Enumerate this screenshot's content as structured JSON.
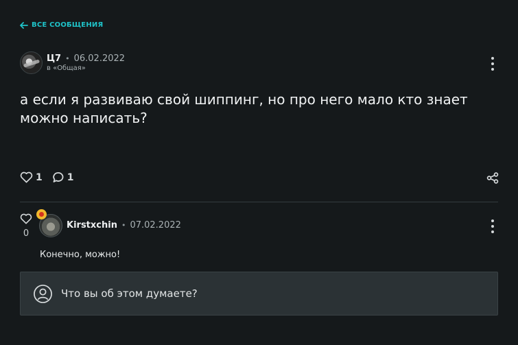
{
  "nav": {
    "back_label": "ВСЕ СООБЩЕНИЯ",
    "back_icon": "arrow-left-icon",
    "accent": "#1fc3c9"
  },
  "post": {
    "author": "Ц7",
    "separator": "•",
    "date": "06.02.2022",
    "category": "в «Общая»",
    "body": "а если я развиваю свой шиппинг, но про него мало кто знает можно написать?",
    "likes": "1",
    "comments": "1"
  },
  "comment": {
    "likes": "0",
    "author": "Kirstxchin",
    "separator": "•",
    "date": "07.02.2022",
    "body": "Конечно, можно!"
  },
  "reply": {
    "placeholder": "Что вы об этом думаете?"
  }
}
